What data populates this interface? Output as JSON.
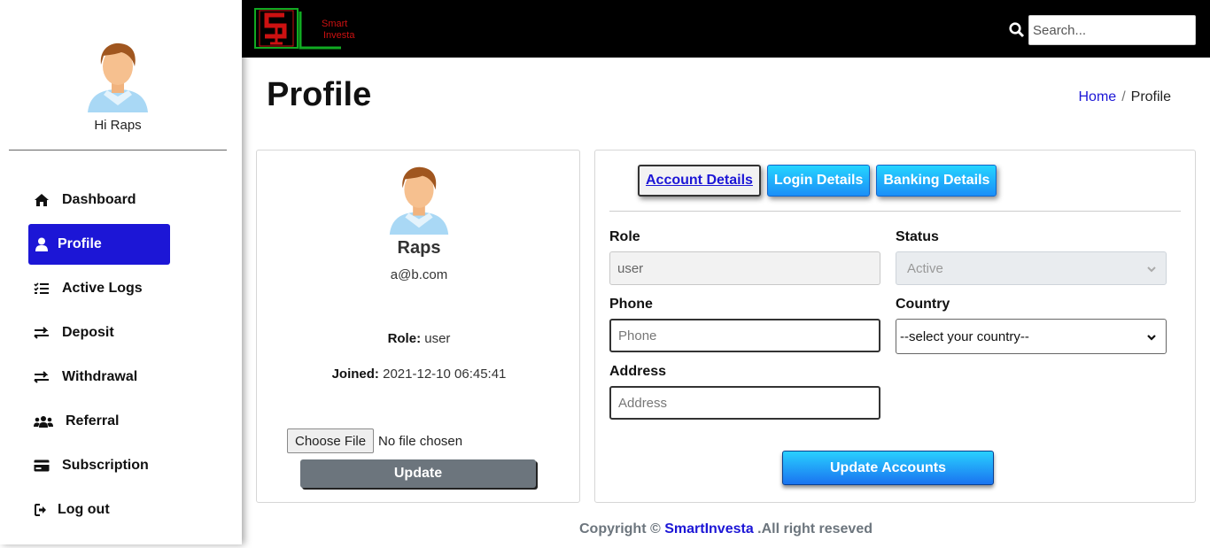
{
  "sidebar": {
    "greeting": "Hi Raps",
    "items": [
      {
        "label": "Dashboard",
        "icon": "home-icon"
      },
      {
        "label": "Profile",
        "icon": "user-icon",
        "active": true
      },
      {
        "label": "Active Logs",
        "icon": "list-check-icon"
      },
      {
        "label": "Deposit",
        "icon": "exchange-icon"
      },
      {
        "label": "Withdrawal",
        "icon": "exchange-icon"
      },
      {
        "label": "Referral",
        "icon": "users-icon"
      },
      {
        "label": "Subscription",
        "icon": "credit-card-icon"
      },
      {
        "label": "Log out",
        "icon": "sign-out-icon"
      }
    ]
  },
  "header": {
    "logo_text": "Smart Investa",
    "logo_line1": "Smart",
    "logo_line2": "Investa",
    "search_placeholder": "Search..."
  },
  "page": {
    "title": "Profile",
    "breadcrumb_home": "Home",
    "breadcrumb_sep": "/",
    "breadcrumb_current": "Profile"
  },
  "profile_card": {
    "name": "Raps",
    "email": "a@b.com",
    "role_label": "Role:",
    "role_value": "user",
    "joined_label": "Joined:",
    "joined_value": "2021-12-10 06:45:41",
    "file_button": "Choose File",
    "file_status": "No file chosen",
    "update_button": "Update"
  },
  "account_card": {
    "tabs": [
      {
        "label": "Account Details",
        "active": true
      },
      {
        "label": "Login Details",
        "active": false
      },
      {
        "label": "Banking Details",
        "active": false
      }
    ],
    "role_label": "Role",
    "role_value": "user",
    "status_label": "Status",
    "status_value": "Active",
    "phone_label": "Phone",
    "phone_placeholder": "Phone",
    "country_label": "Country",
    "country_value": "--select your country--",
    "address_label": "Address",
    "address_placeholder": "Address",
    "update_button": "Update Accounts"
  },
  "footer": {
    "prefix": "Copyright ©",
    "brand": "SmartInvesta",
    "suffix": ".All right reseved"
  },
  "colors": {
    "accent": "#1c16d6",
    "topbar": "#000000",
    "logo_red": "#cc1111",
    "logo_green": "#11aa22"
  }
}
